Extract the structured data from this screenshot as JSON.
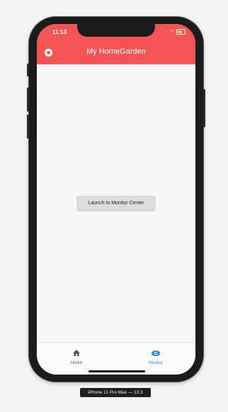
{
  "status_bar": {
    "time": "11:13"
  },
  "app_bar": {
    "title": "My HomeGarden",
    "icon": "app-logo-icon"
  },
  "main": {
    "launch_button_label": "Launch to Monitor Center"
  },
  "tabs": [
    {
      "label": "Home",
      "icon": "home-icon",
      "active": false
    },
    {
      "label": "Monitor",
      "icon": "eye-icon",
      "active": true
    }
  ],
  "device_label": "iPhone 11 Pro Max — 13.3",
  "colors": {
    "header": "#f55456",
    "active_tab": "#2a8ad6"
  }
}
